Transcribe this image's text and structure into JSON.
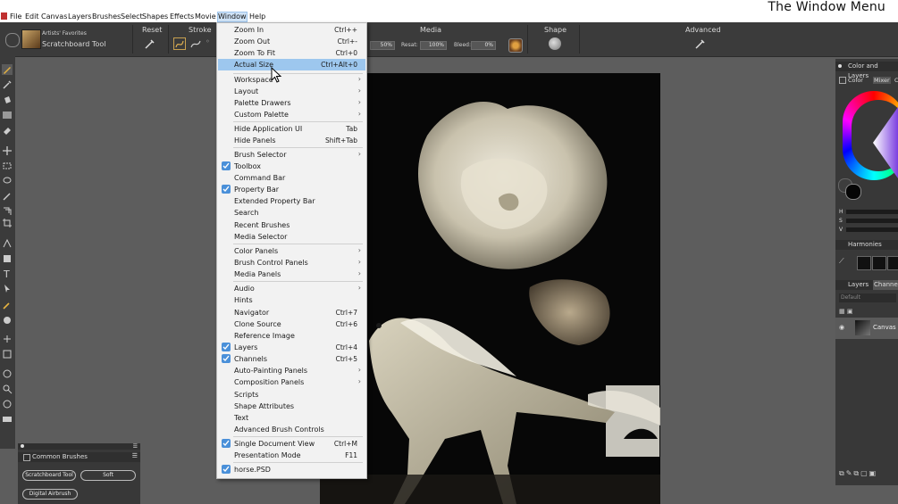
{
  "menubar": {
    "items": [
      "File",
      "Edit",
      "Canvas",
      "Layers",
      "Brushes",
      "Select",
      "Shapes",
      "Effects",
      "Movie",
      "Window",
      "Help"
    ],
    "active": "Window"
  },
  "video_title": "The Window Menu",
  "propbar": {
    "brush_category": "Artists' Favorites",
    "brush_variant": "Scratchboard Tool",
    "reset_label": "Reset",
    "stroke_label": "Stroke",
    "media_label": "Media",
    "shape_label": "Shape",
    "advanced_label": "Advanced",
    "opacity_value": "50%",
    "resat_label": "Resat:",
    "resat_value": "100%",
    "bleed_label": "Bleed:",
    "bleed_value": "0%"
  },
  "menu": {
    "items": [
      {
        "label": "Zoom In",
        "shortcut": "Ctrl++"
      },
      {
        "label": "Zoom Out",
        "shortcut": "Ctrl+-"
      },
      {
        "label": "Zoom To Fit",
        "shortcut": "Ctrl+0"
      },
      {
        "label": "Actual Size",
        "shortcut": "Ctrl+Alt+0"
      },
      {
        "label": "Workspace",
        "shortcut": ""
      },
      {
        "label": "Layout",
        "shortcut": ""
      },
      {
        "label": "Palette Drawers",
        "shortcut": ""
      },
      {
        "label": "Custom Palette",
        "shortcut": ""
      },
      {
        "label": "Hide Application UI",
        "shortcut": "Tab"
      },
      {
        "label": "Hide Panels",
        "shortcut": "Shift+Tab"
      },
      {
        "label": "Brush Selector",
        "shortcut": ""
      },
      {
        "label": "Toolbox",
        "shortcut": ""
      },
      {
        "label": "Command Bar",
        "shortcut": ""
      },
      {
        "label": "Property Bar",
        "shortcut": ""
      },
      {
        "label": "Extended Property Bar",
        "shortcut": ""
      },
      {
        "label": "Search",
        "shortcut": ""
      },
      {
        "label": "Recent Brushes",
        "shortcut": ""
      },
      {
        "label": "Media Selector",
        "shortcut": ""
      },
      {
        "label": "Color Panels",
        "shortcut": ""
      },
      {
        "label": "Brush Control Panels",
        "shortcut": ""
      },
      {
        "label": "Media Panels",
        "shortcut": ""
      },
      {
        "label": "Audio",
        "shortcut": ""
      },
      {
        "label": "Hints",
        "shortcut": ""
      },
      {
        "label": "Navigator",
        "shortcut": "Ctrl+7"
      },
      {
        "label": "Clone Source",
        "shortcut": "Ctrl+6"
      },
      {
        "label": "Reference Image",
        "shortcut": ""
      },
      {
        "label": "Layers",
        "shortcut": "Ctrl+4"
      },
      {
        "label": "Channels",
        "shortcut": "Ctrl+5"
      },
      {
        "label": "Auto-Painting Panels",
        "shortcut": ""
      },
      {
        "label": "Composition Panels",
        "shortcut": ""
      },
      {
        "label": "Scripts",
        "shortcut": ""
      },
      {
        "label": "Shape Attributes",
        "shortcut": ""
      },
      {
        "label": "Text",
        "shortcut": ""
      },
      {
        "label": "Advanced Brush Controls",
        "shortcut": ""
      },
      {
        "label": "Single Document View",
        "shortcut": "Ctrl+M"
      },
      {
        "label": "Presentation Mode",
        "shortcut": "F11"
      },
      {
        "label": "horse.PSD",
        "shortcut": ""
      }
    ]
  },
  "right_panel": {
    "title": "Color and Layers",
    "color_tabs": [
      "Color",
      "Mixer",
      "C"
    ],
    "hsv": [
      "H",
      "S",
      "V"
    ],
    "harmonies": "Harmonies",
    "layer_tabs": [
      "Layers",
      "Channels"
    ],
    "composite": "Default",
    "canvas_layer": "Canvas"
  },
  "brushes_panel": {
    "title": "Common Brushes",
    "brushes": [
      "Scratchboard Tool",
      "Soft",
      "Digital Airbrush"
    ]
  },
  "colors": {
    "accent": "#4a90d9",
    "highlight": "#9dc7ee",
    "panel": "#383838"
  }
}
